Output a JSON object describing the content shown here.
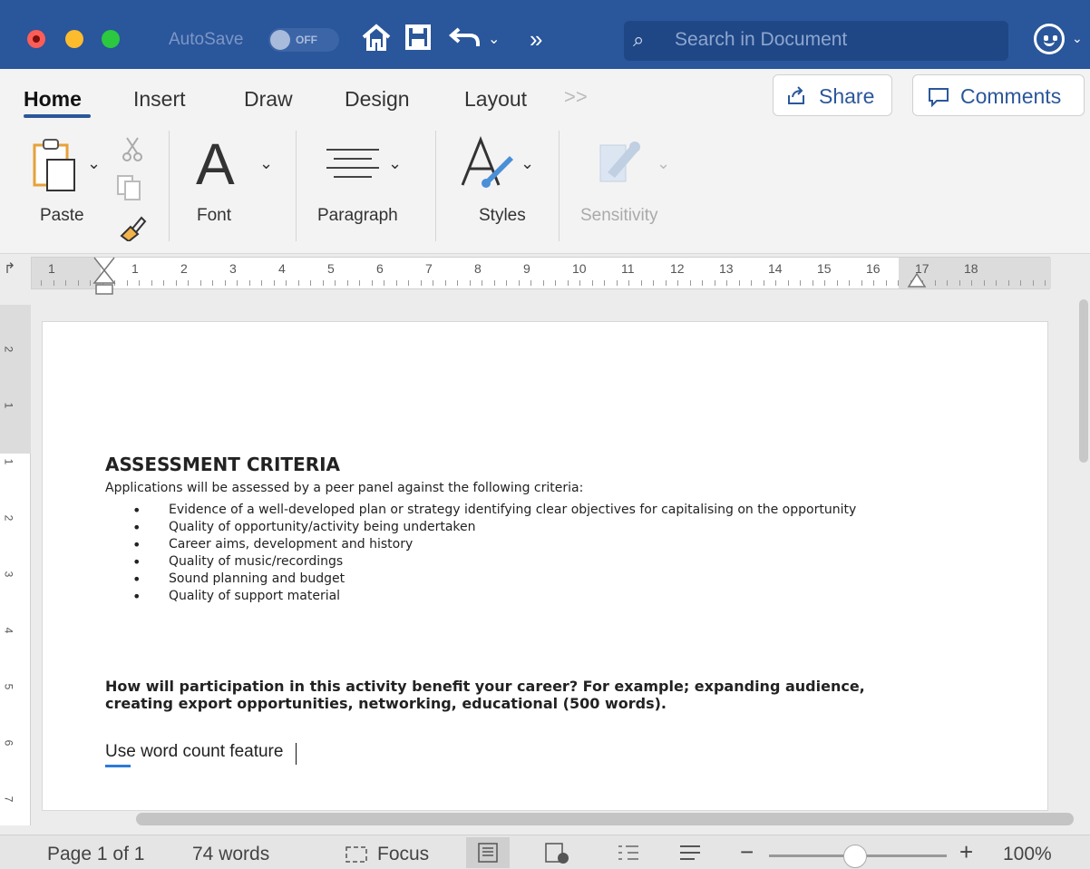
{
  "titlebar": {
    "autosave_label": "AutoSave",
    "autosave_state": "OFF",
    "search_placeholder": "Search in Document"
  },
  "tabs": [
    "Home",
    "Insert",
    "Draw",
    "Design",
    "Layout"
  ],
  "actions": {
    "share": "Share",
    "comments": "Comments"
  },
  "ribbon": {
    "paste": "Paste",
    "font": "Font",
    "font_glyph": "A",
    "paragraph": "Paragraph",
    "styles": "Styles",
    "sensitivity": "Sensitivity"
  },
  "ruler": {
    "left_number": "1",
    "numbers": [
      "1",
      "2",
      "3",
      "4",
      "5",
      "6",
      "7",
      "8",
      "9",
      "10",
      "11",
      "12",
      "13",
      "14",
      "15",
      "16",
      "17",
      "18"
    ],
    "vertical_numbers": [
      "2",
      "1",
      "1",
      "2",
      "3",
      "4",
      "5",
      "6",
      "7"
    ]
  },
  "document": {
    "heading": "ASSESSMENT CRITERIA",
    "intro": "Applications will be assessed by a peer panel against the following criteria:",
    "criteria": [
      "Evidence of a well-developed plan or strategy identifying clear objectives for capitalising on the opportunity",
      "Quality of opportunity/activity being undertaken",
      "Career aims, development and history",
      "Quality of music/recordings",
      "Sound planning and budget",
      "Quality of support material"
    ],
    "question": "How will participation in this activity benefit your career? For example; expanding audience, creating export opportunities, networking, educational (500 words).",
    "answer": "Use word count feature"
  },
  "status": {
    "page": "Page 1 of 1",
    "words": "74 words",
    "focus": "Focus",
    "zoom": "100%"
  },
  "colors": {
    "titlebar": "#2a569b",
    "accent": "#2b579a"
  }
}
